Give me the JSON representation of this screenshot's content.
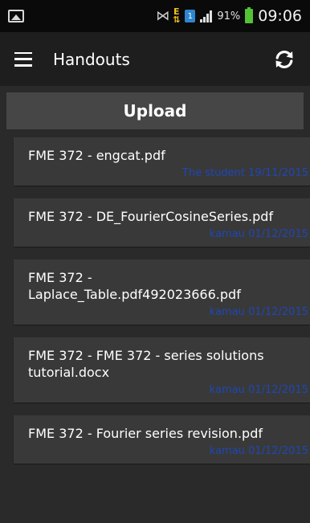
{
  "status_bar": {
    "battery_percent": "91%",
    "battery_level": 0.91,
    "time": "09:06",
    "sim_label": "1",
    "icons": [
      "gallery-icon",
      "no-signal-icon",
      "data-transfer-icon",
      "sim-icon",
      "signal-icon",
      "battery-icon"
    ]
  },
  "toolbar": {
    "title": "Handouts",
    "menu_icon": "hamburger-menu-icon",
    "refresh_icon": "refresh-icon"
  },
  "upload": {
    "label": "Upload"
  },
  "handouts": [
    {
      "title": "FME 372 - engcat.pdf",
      "owner": "The student",
      "date": "19/11/2015"
    },
    {
      "title": "FME 372 - DE_FourierCosineSeries.pdf",
      "owner": "kamau",
      "date": "01/12/2015"
    },
    {
      "title": "FME 372 - Laplace_Table.pdf492023666.pdf",
      "owner": "kamau",
      "date": "01/12/2015"
    },
    {
      "title": "FME 372 - FME 372 - series solutions tutorial.docx",
      "owner": "kamau",
      "date": "01/12/2015"
    },
    {
      "title": "FME 372 - Fourier series revision.pdf",
      "owner": "kamau",
      "date": "01/12/2015"
    }
  ],
  "colors": {
    "background": "#2a2a2a",
    "toolbar": "#1e1e1e",
    "card": "#393939",
    "upload_button": "#464646",
    "meta_text": "#1f47b5",
    "battery": "#55c135",
    "sim": "#2e86d0"
  }
}
